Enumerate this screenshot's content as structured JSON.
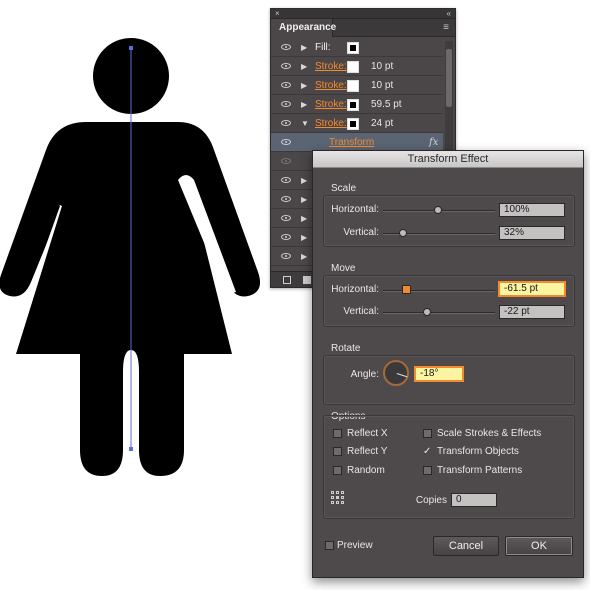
{
  "appearance_panel": {
    "close_glyph": "×",
    "collapse_glyph": "«",
    "tab_label": "Appearance",
    "menu_glyph": "≡",
    "rows": [
      {
        "label": "Fill:",
        "swatch": "black",
        "value": "",
        "expanded": false,
        "link": false
      },
      {
        "label": "Stroke:",
        "swatch": "white",
        "value": "10 pt",
        "expanded": false,
        "link": true
      },
      {
        "label": "Stroke:",
        "swatch": "white",
        "value": "10 pt",
        "expanded": false,
        "link": true
      },
      {
        "label": "Stroke:",
        "swatch": "black",
        "value": "59.5 pt",
        "expanded": false,
        "link": true
      },
      {
        "label": "Stroke:",
        "swatch": "black",
        "value": "24 pt",
        "expanded": true,
        "link": true
      }
    ],
    "transform_row": {
      "label": "Transform",
      "fx": "fx"
    },
    "collapsed_glyph": "▶",
    "expanded_glyph": "▼"
  },
  "dialog": {
    "title": "Transform Effect",
    "scale": {
      "heading": "Scale",
      "horizontal_label": "Horizontal:",
      "horizontal_value": "100%",
      "vertical_label": "Vertical:",
      "vertical_value": "32%"
    },
    "move": {
      "heading": "Move",
      "horizontal_label": "Horizontal:",
      "horizontal_value": "-61.5 pt",
      "vertical_label": "Vertical:",
      "vertical_value": "-22 pt"
    },
    "rotate": {
      "heading": "Rotate",
      "angle_label": "Angle:",
      "angle_value": "-18°"
    },
    "options": {
      "heading": "Options",
      "reflect_x": "Reflect X",
      "reflect_y": "Reflect Y",
      "random": "Random",
      "scale_strokes": "Scale Strokes & Effects",
      "transform_objects": "Transform Objects",
      "transform_patterns": "Transform Patterns",
      "checkmark": "✓",
      "copies_label": "Copies",
      "copies_value": "0"
    },
    "preview_label": "Preview",
    "cancel_label": "Cancel",
    "ok_label": "OK"
  },
  "colors": {
    "figure": "#000000",
    "guide_line": "#5b6fd6",
    "accent_orange": "#f28a2e",
    "panel_bg": "#4b4748"
  }
}
